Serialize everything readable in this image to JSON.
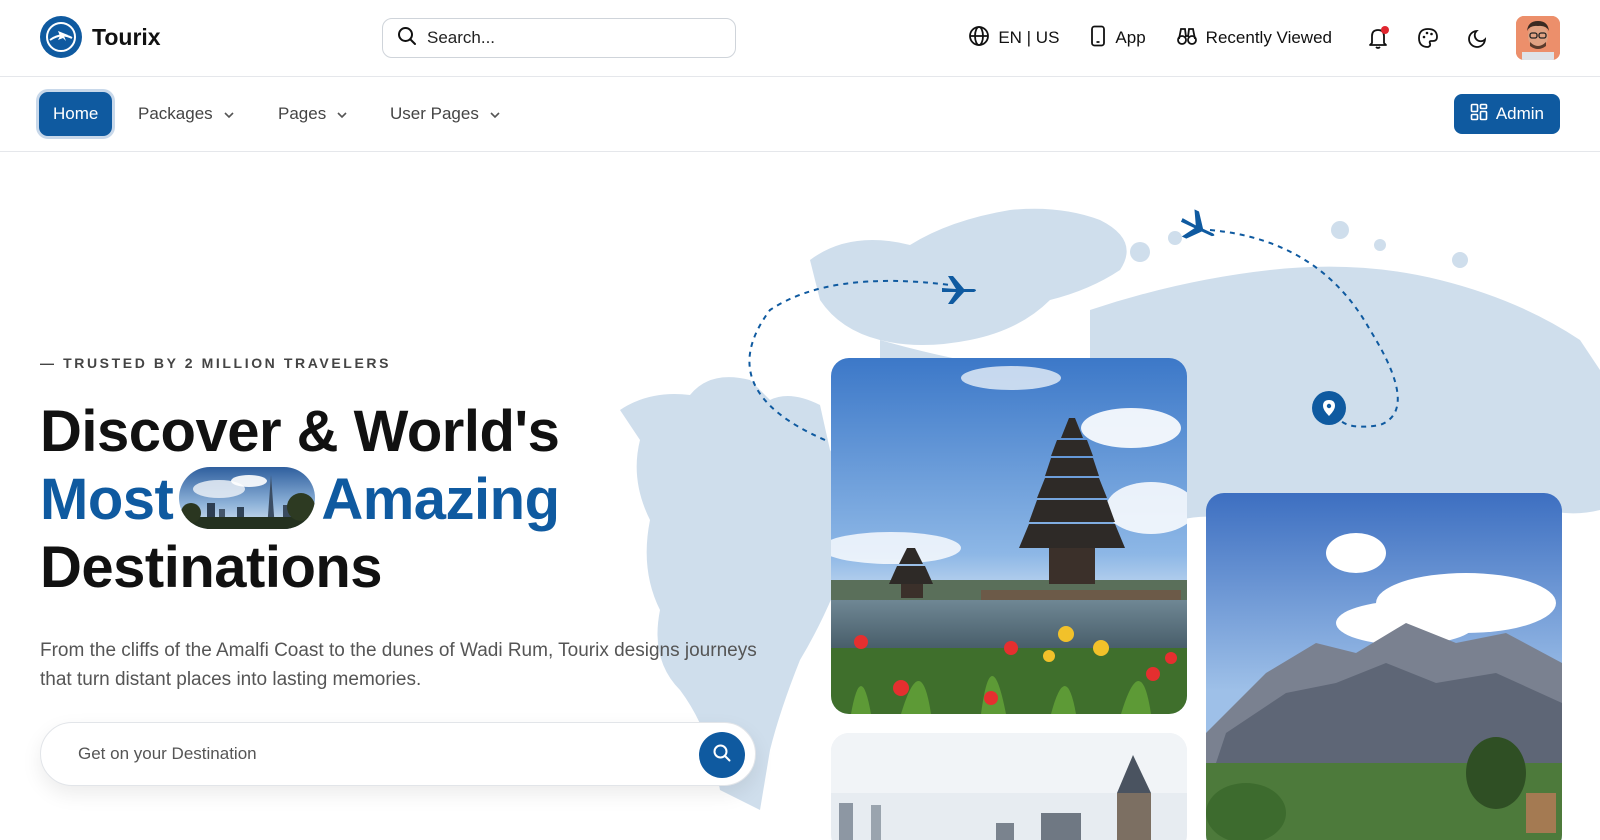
{
  "header": {
    "brand": "Tourix",
    "search_placeholder": "Search...",
    "language": "EN | US",
    "app_label": "App",
    "recently_viewed": "Recently Viewed",
    "icons": [
      "globe-icon",
      "phone-icon",
      "binoculars-icon",
      "bell-icon",
      "palette-icon",
      "moon-icon"
    ]
  },
  "nav": {
    "items": [
      {
        "label": "Home",
        "active": true
      },
      {
        "label": "Packages",
        "dropdown": true
      },
      {
        "label": "Pages",
        "dropdown": true
      },
      {
        "label": "User Pages",
        "dropdown": true
      }
    ],
    "admin_label": "Admin"
  },
  "hero": {
    "eyebrow": "— TRUSTED BY 2 MILLION TRAVELERS",
    "title_line1": "Discover & World's",
    "title_word_most": "Most",
    "title_word_amazing": "Amazing",
    "title_line3": "Destinations",
    "description": "From the cliffs of the Amalfi Coast to the dunes of Wadi Rum, Tourix designs journeys that turn distant places into lasting memories.",
    "destination_placeholder": "Get on your Destination"
  },
  "colors": {
    "brand": "#0f5aa0",
    "map": "#cfdeec",
    "notification": "#e0262f"
  }
}
